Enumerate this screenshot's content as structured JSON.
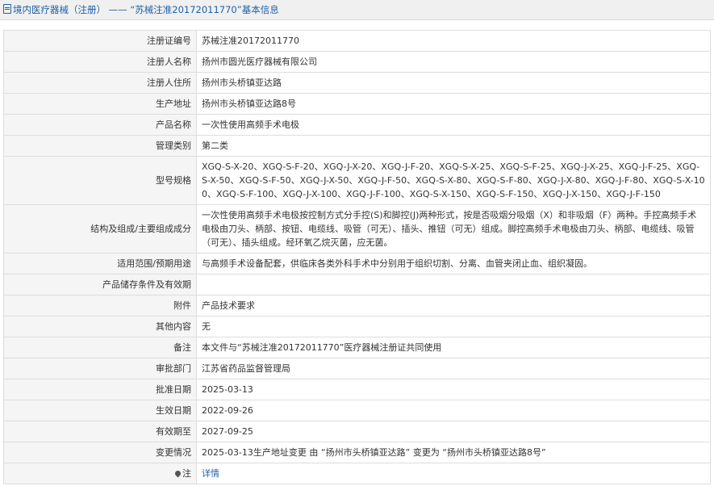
{
  "header": {
    "category": "境内医疗器械（注册）",
    "separator": "——",
    "record_title": "“苏械注准20172011770”基本信息"
  },
  "rows": [
    {
      "label": "注册证编号",
      "value": "苏械注准20172011770"
    },
    {
      "label": "注册人名称",
      "value": "扬州市圆光医疗器械有限公司"
    },
    {
      "label": "注册人住所",
      "value": "扬州市头桥镇亚达路"
    },
    {
      "label": "生产地址",
      "value": "扬州市头桥镇亚达路8号"
    },
    {
      "label": "产品名称",
      "value": "一次性使用高频手术电极"
    },
    {
      "label": "管理类别",
      "value": "第二类"
    },
    {
      "label": "型号规格",
      "value": "XGQ-S-X-20、XGQ-S-F-20、XGQ-J-X-20、XGQ-J-F-20、XGQ-S-X-25、XGQ-S-F-25、XGQ-J-X-25、XGQ-J-F-25、XGQ-S-X-50、XGQ-S-F-50、XGQ-J-X-50、XGQ-J-F-50、XGQ-S-X-80、XGQ-S-F-80、XGQ-J-X-80、XGQ-J-F-80、XGQ-S-X-100、XGQ-S-F-100、XGQ-J-X-100、XGQ-J-F-100、XGQ-S-X-150、XGQ-S-F-150、XGQ-J-X-150、XGQ-J-F-150"
    },
    {
      "label": "结构及组成/主要组成成分",
      "value": "一次性使用高频手术电极按控制方式分手控(S)和脚控(J)两种形式，按是否吸烟分吸烟（X）和非吸烟（F）两种。手控高频手术电极由刀头、柄部、按钮、电缆线、吸管（可无）、插头、推钮（可无）组成。脚控高频手术电极由刀头、柄部、电缆线、吸管（可无）、插头组成。经环氧乙烷灭菌，应无菌。"
    },
    {
      "label": "适用范围/预期用途",
      "value": "与高频手术设备配套，供临床各类外科手术中分别用于组织切割、分离、血管夹闭止血、组织凝固。"
    },
    {
      "label": "产品储存条件及有效期",
      "value": ""
    },
    {
      "label": "附件",
      "value": "产品技术要求"
    },
    {
      "label": "其他内容",
      "value": "无"
    },
    {
      "label": "备注",
      "value": "本文件与“苏械注准20172011770”医疗器械注册证共同使用"
    },
    {
      "label": "审批部门",
      "value": "江苏省药品监督管理局"
    },
    {
      "label": "批准日期",
      "value": "2025-03-13"
    },
    {
      "label": "生效日期",
      "value": "2022-09-26"
    },
    {
      "label": "有效期至",
      "value": "2027-09-25"
    },
    {
      "label": "变更情况",
      "value": "2025-03-13生产地址变更 由 “扬州市头桥镇亚达路” 变更为 “扬州市头桥镇亚达路8号”"
    }
  ],
  "note_row": {
    "label": "注",
    "link": "详情",
    "icon": "pin-icon"
  },
  "colors": {
    "link": "#1f5fa8",
    "label_bg": "#f5f5f5",
    "border": "#dddddd"
  }
}
